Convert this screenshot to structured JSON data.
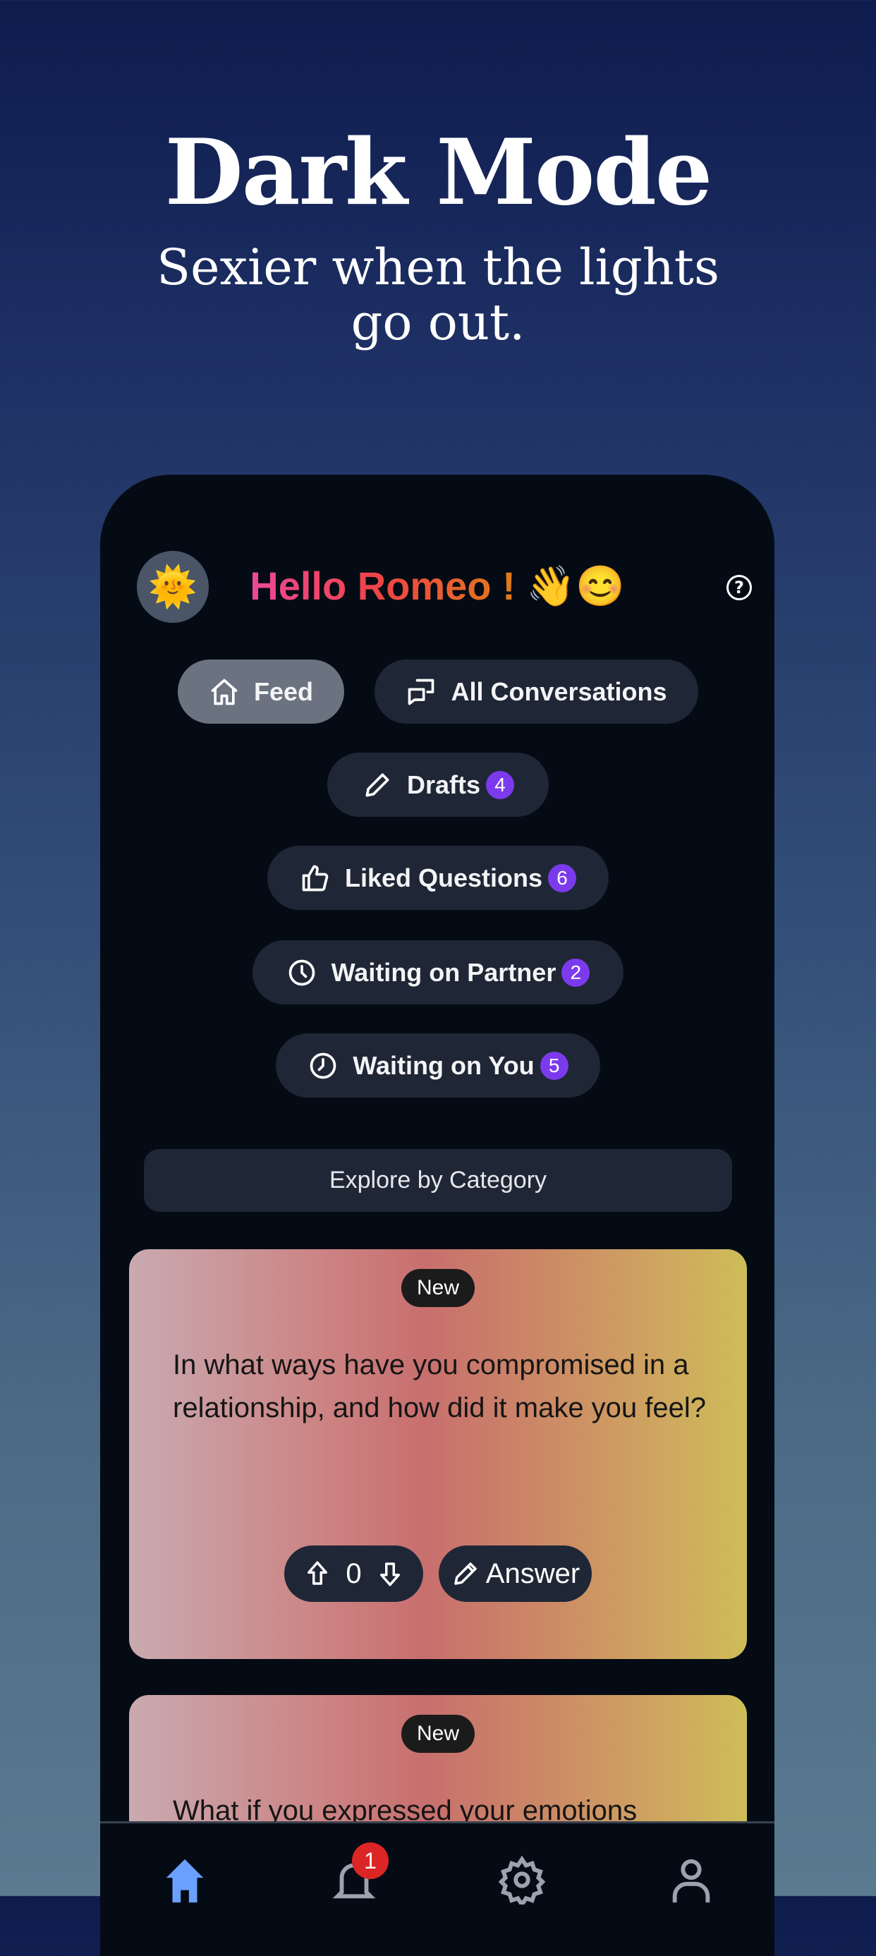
{
  "hero": {
    "title": "Dark Mode",
    "subtitle": "Sexier when the lights go out."
  },
  "header": {
    "avatar_emoji": "🌞",
    "greeting": "Hello Romeo !",
    "greeting_emoji": "👋😊",
    "help_icon": "?"
  },
  "nav_pills": [
    {
      "label": "Feed",
      "icon": "home-icon",
      "active": true
    },
    {
      "label": "All Conversations",
      "icon": "conversations-icon"
    },
    {
      "label": "Drafts",
      "icon": "pencil-icon",
      "count": "4"
    },
    {
      "label": "Liked Questions",
      "icon": "thumbs-up-icon",
      "count": "6"
    },
    {
      "label": "Waiting on Partner",
      "icon": "clock-icon",
      "count": "2"
    },
    {
      "label": "Waiting on You",
      "icon": "clock-icon",
      "count": "5"
    }
  ],
  "explore_label": "Explore by Category",
  "cards": [
    {
      "badge": "New",
      "question": "In what ways have you compromised in a relationship, and how did it make you feel?",
      "votes": "0",
      "answer_label": "Answer"
    },
    {
      "badge": "New",
      "question": "What if you expressed your emotions"
    }
  ],
  "bottom_nav": {
    "items": [
      "home",
      "notifications",
      "settings",
      "profile"
    ],
    "notification_count": "1",
    "active_color": "#6aa0ff"
  }
}
